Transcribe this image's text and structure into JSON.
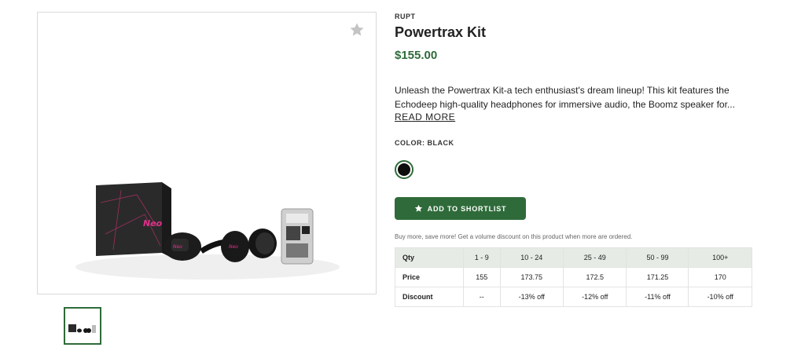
{
  "product": {
    "brand": "RUPT",
    "title": "Powertrax Kit",
    "price": "$155.00",
    "description": "Unleash the Powertrax Kit-a tech enthusiast's dream lineup! This kit features the Echodeep high-quality headphones for immersive audio, the Boomz speaker for...",
    "read_more": "READ MORE",
    "color_label": "COLOR: BLACK",
    "color_value": "#0d0d0d",
    "add_to_shortlist": "ADD TO SHORTLIST",
    "image_logo_text": "Neo"
  },
  "volume": {
    "note": "Buy more, save more! Get a volume discount on this product when more are ordered.",
    "headers": [
      "Qty",
      "1 - 9",
      "10 - 24",
      "25 - 49",
      "50 - 99",
      "100+"
    ],
    "price_row": [
      "Price",
      "155",
      "173.75",
      "172.5",
      "171.25",
      "170"
    ],
    "discount_row": [
      "Discount",
      "--",
      "-13% off",
      "-12% off",
      "-11% off",
      "-10% off"
    ]
  },
  "icons": {
    "favorite": "star-icon",
    "button": "star-icon"
  },
  "colors": {
    "accent": "#2f6b3a",
    "table_header": "#e6ebe6"
  }
}
